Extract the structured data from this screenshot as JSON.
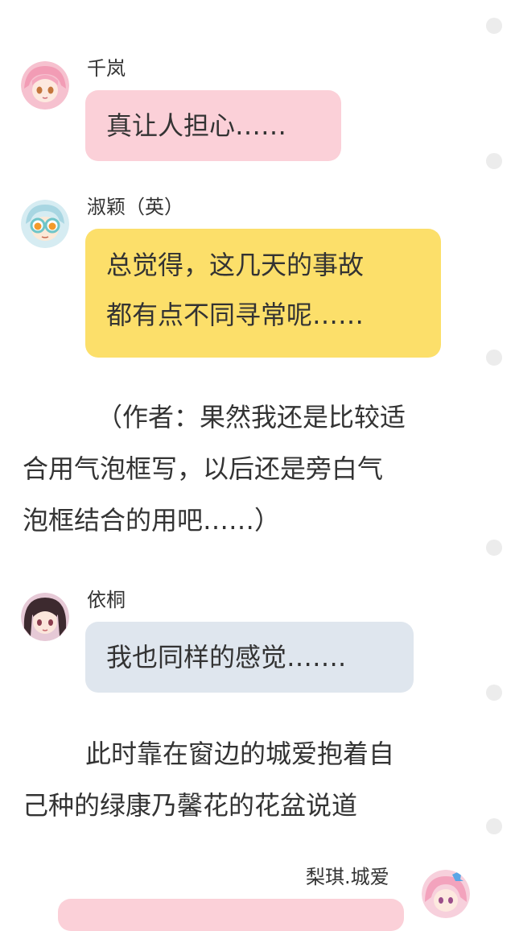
{
  "colors": {
    "bubble_pink": "#fbd0d8",
    "bubble_yellow": "#fcdf6a",
    "bubble_gray": "#dfe6ee",
    "side_dot": "#ececec"
  },
  "messages": [
    {
      "sender": "千岚",
      "avatar": "pink-haired-girl-avatar",
      "text": "真让人担心……",
      "color": "pink"
    },
    {
      "sender": "淑颖（英）",
      "avatar": "goggles-character-avatar",
      "lines": [
        "总觉得，这几天的事故",
        "都有点不同寻常呢……"
      ],
      "color": "yellow"
    },
    {
      "sender": "依桐",
      "avatar": "dark-haired-girl-avatar",
      "text": "我也同样的感觉…….",
      "color": "gray"
    },
    {
      "sender": "梨琪.城爱",
      "avatar": "pink-haired-blue-bow-avatar",
      "color": "pink",
      "side": "right"
    }
  ],
  "narration": [
    {
      "lines": [
        "（作者：果然我还是比较适",
        "合用气泡框写，以后还是旁白气",
        "泡框结合的用吧……）"
      ]
    },
    {
      "lines": [
        "此时靠在窗边的城爱抱着自",
        "己种的绿康乃馨花的花盆说道"
      ]
    }
  ]
}
